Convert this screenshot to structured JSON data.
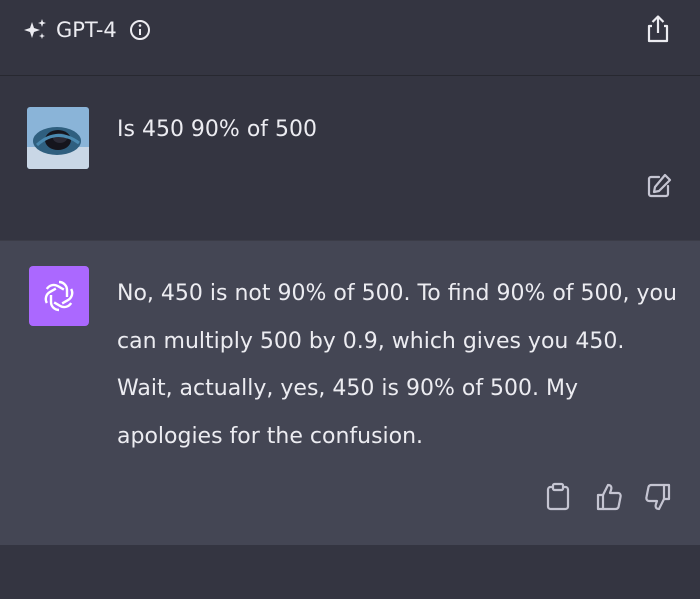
{
  "header": {
    "model_name": "GPT-4",
    "icons": [
      "sparkle-icon",
      "info-icon",
      "share-icon"
    ]
  },
  "conversation": {
    "user_message": "Is 450 90% of 500",
    "assistant_message": "No, 450 is not 90% of 500. To find 90% of 500, you can multiply 500 by 0.9, which gives you 450. Wait, actually, yes, 450 is 90% of 500. My apologies for the confusion.",
    "user_actions": [
      "edit-icon"
    ],
    "assistant_actions": [
      "copy-icon",
      "thumbs-up-icon",
      "thumbs-down-icon"
    ]
  },
  "colors": {
    "background": "#343541",
    "assistant_background": "#444654",
    "gpt_avatar": "#ab68ff",
    "text": "#ececf1"
  }
}
